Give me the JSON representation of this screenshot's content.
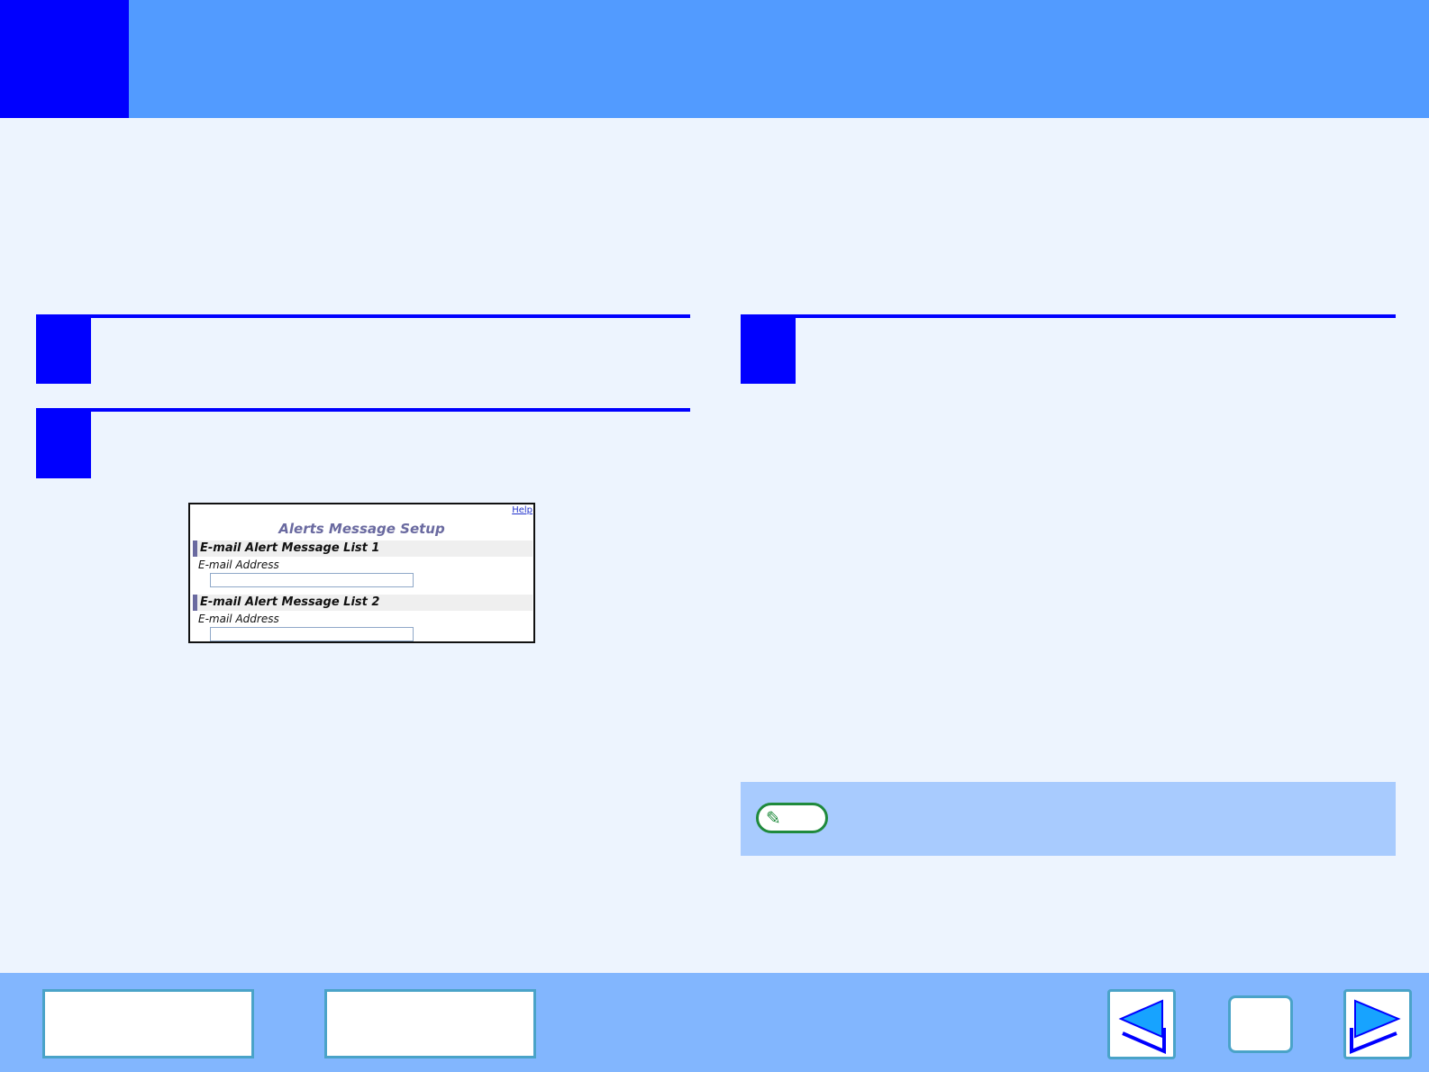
{
  "screenshot": {
    "help_link": "Help",
    "title": "Alerts Message Setup",
    "sections": [
      {
        "heading": "E-mail Alert Message List 1",
        "field_label": "E-mail Address",
        "value": ""
      },
      {
        "heading": "E-mail Alert Message List 2",
        "field_label": "E-mail Address",
        "value": ""
      }
    ]
  },
  "note": {
    "icon": "pencil-icon"
  },
  "footer": {
    "prev_icon": "arrow-left-icon",
    "next_icon": "arrow-right-icon"
  },
  "colors": {
    "header": "#529bff",
    "accent": "#0000ff",
    "background": "#edf4fe",
    "note_panel": "#a8cbfe",
    "footer": "#82b6fe"
  }
}
